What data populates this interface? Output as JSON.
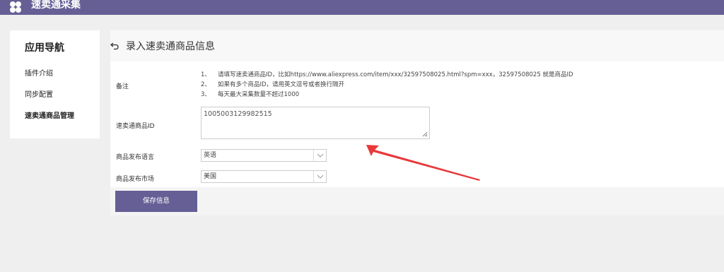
{
  "header": {
    "app_title": "速卖通采集"
  },
  "sidebar": {
    "title": "应用导航",
    "items": [
      {
        "label": "插件介绍",
        "active": false
      },
      {
        "label": "同步配置",
        "active": false
      },
      {
        "label": "速卖通商品管理",
        "active": true
      }
    ]
  },
  "page": {
    "title": "录入速卖通商品信息"
  },
  "form": {
    "notes_label": "备注",
    "notes": [
      {
        "num": "1、",
        "text": "请填写速卖通商品ID，比如https://www.aliexpress.com/item/xxx/32597508025.html?spm=xxx，32597508025 就是商品ID"
      },
      {
        "num": "2、",
        "text": "如果有多个商品ID，请用英文逗号或者换行隔开"
      },
      {
        "num": "3、",
        "text": "每天最大采集数量不超过1000"
      }
    ],
    "id_label": "速卖通商品ID",
    "id_value": "1005003129982515",
    "language_label": "商品发布语言",
    "language_value": "英语",
    "market_label": "商品发布市场",
    "market_value": "美国",
    "save_label": "保存信息"
  },
  "colors": {
    "brand": "#655f95",
    "arrow": "#e8383a"
  }
}
